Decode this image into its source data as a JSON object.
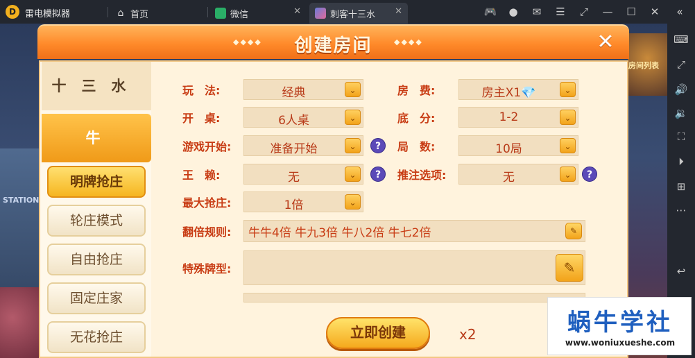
{
  "titlebar": {
    "app_title": "雷电模拟器",
    "tabs": [
      {
        "label": "首页"
      },
      {
        "label": "微信"
      },
      {
        "label": "刺客十三水"
      }
    ]
  },
  "game": {
    "bg_station": "STATION",
    "bg_room_list": "房间列表",
    "dialog": {
      "title": "创建房间",
      "deco_left": "◆◆◆◆",
      "deco_right": "◆◆◆◆",
      "nav": {
        "tabs": [
          {
            "label": "十三水",
            "active": false
          },
          {
            "label": "牛牛",
            "active": true
          }
        ],
        "modes": [
          {
            "label": "明牌抢庄",
            "active": true
          },
          {
            "label": "轮庄模式",
            "active": false
          },
          {
            "label": "自由抢庄",
            "active": false
          },
          {
            "label": "固定庄家",
            "active": false
          },
          {
            "label": "无花抢庄",
            "active": false
          }
        ]
      },
      "form": {
        "play": {
          "label": "玩　法:",
          "value": "经典"
        },
        "fee": {
          "label": "房　费:",
          "value": "房主X1💎"
        },
        "table": {
          "label": "开　桌:",
          "value": "6人桌"
        },
        "base": {
          "label": "底　分:",
          "value": "1-2"
        },
        "start": {
          "label": "游戏开始:",
          "value": "准备开始"
        },
        "rounds": {
          "label": "局　数:",
          "value": "10局"
        },
        "wild": {
          "label": "王　赖:",
          "value": "无"
        },
        "bet": {
          "label": "推注选项:",
          "value": "无"
        },
        "maxgrab": {
          "label": "最大抢庄:",
          "value": "1倍"
        },
        "double_rule": {
          "label": "翻倍规则:",
          "value": "牛牛4倍 牛九3倍 牛八2倍 牛七2倍"
        },
        "special": {
          "label": "特殊牌型:",
          "value": ""
        }
      },
      "create_button": "立即创建",
      "cost": "x2"
    }
  },
  "watermark": {
    "main": "蜗牛学社",
    "sub": "www.woniuxueshe.com"
  },
  "colors": {
    "accent": "#f09a18",
    "label_red": "#c83c14",
    "header_orange": "#ff8a2a"
  }
}
